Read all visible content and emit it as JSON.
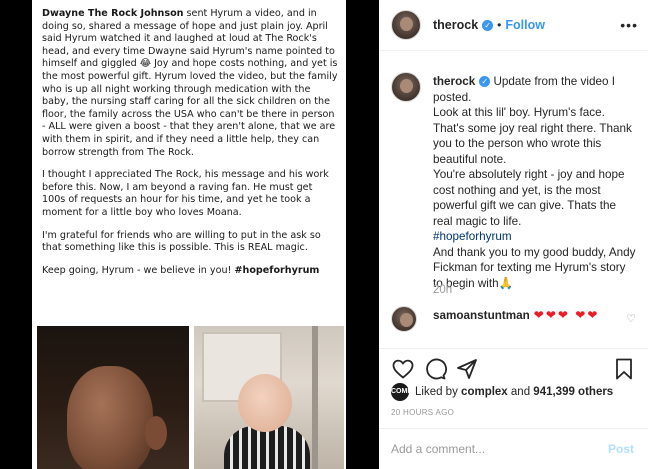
{
  "post_image": {
    "paragraph1_bold": "Dwayne The Rock Johnson",
    "paragraph1_rest": " sent Hyrum a video, and in doing so, shared a message of hope and just plain joy. April said Hyrum watched it and laughed at loud at The Rock's head, and every time Dwayne said Hyrum's name pointed to himself and giggled 😂 Joy and hope costs nothing, and yet is the most powerful gift. Hyrum loved the video, but the family who is up all night working through medication with the baby, the nursing staff caring for all the sick children on the floor, the family across the USA who can't be there in person - ALL were given a boost - that they aren't alone, that we are with them in spirit, and if they need a little help, they can borrow strength from The Rock.",
    "paragraph2": "I thought I appreciated The Rock, his message and his work before this. Now, I am beyond a raving fan. He must get 100s of requests an hour for his time, and yet he took a moment for a little boy who loves Moana.",
    "paragraph3": "I'm grateful for friends who are willing to put in the ask so that something like this is possible. This is REAL magic.",
    "paragraph4_rest": "Keep going, Hyrum - we believe in you! ",
    "paragraph4_bold": "#hopeforhyrum"
  },
  "header": {
    "username": "therock",
    "verified_mark": "✓",
    "separator": "•",
    "follow_label": "Follow",
    "more_label": "•••"
  },
  "caption": {
    "username": "therock",
    "verified_mark": "✓",
    "text_part1": " Update from the video I posted.\nLook at this lil' boy. Hyrum's face. That's some joy real right there. Thank you to the person who wrote this beautiful note.\nYou're absolutely right - joy and hope cost nothing and yet, is the most powerful gift we can give. Thats the real magic to life.\n",
    "hashtag": "#hopeforhyrum",
    "text_part2": "\nAnd thank you to my good buddy, Andy Fickman for texting me Hyrum's story to begin with🙏",
    "time": "20h"
  },
  "comment": {
    "username": "samoanstuntman",
    "hearts": "❤❤❤ ❤❤",
    "like_icon": "♡"
  },
  "likes": {
    "mini_avatar_label": "COMPLEX",
    "prefix": "Liked by ",
    "first_user": "complex",
    "middle": " and ",
    "count": "941,399 others"
  },
  "timestamp": "20 HOURS AGO",
  "add_comment": {
    "placeholder": "Add a comment...",
    "post_label": "Post"
  },
  "colors": {
    "link_blue": "#3897f0",
    "heart_red": "#ed1c24",
    "hashtag": "#003569"
  },
  "icons": [
    "heart-icon",
    "comment-icon",
    "share-icon",
    "bookmark-icon"
  ]
}
